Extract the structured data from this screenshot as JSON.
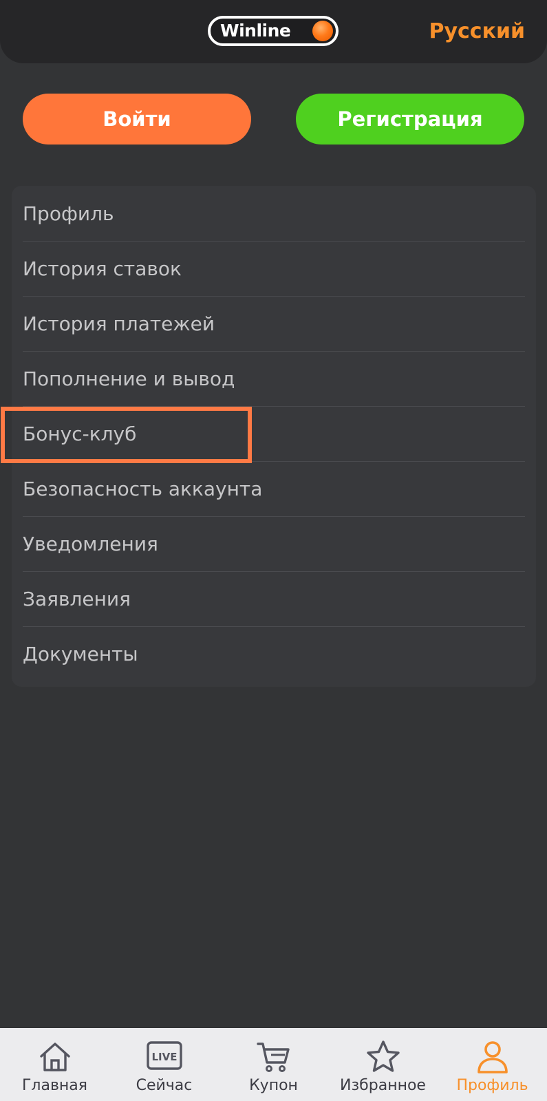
{
  "header": {
    "logo_text": "Winline",
    "language": "Русский"
  },
  "auth": {
    "login_label": "Войти",
    "register_label": "Регистрация"
  },
  "menu": {
    "items": [
      {
        "label": "Профиль"
      },
      {
        "label": "История ставок"
      },
      {
        "label": "История платежей"
      },
      {
        "label": "Пополнение и вывод"
      },
      {
        "label": "Бонус-клуб",
        "highlighted": true
      },
      {
        "label": "Безопасность аккаунта"
      },
      {
        "label": "Уведомления"
      },
      {
        "label": "Заявления"
      },
      {
        "label": "Документы"
      }
    ]
  },
  "tabbar": {
    "tabs": [
      {
        "label": "Главная",
        "icon": "home-icon"
      },
      {
        "label": "Сейчас",
        "icon": "live-icon",
        "icon_text": "LIVE"
      },
      {
        "label": "Купон",
        "icon": "cart-icon"
      },
      {
        "label": "Избранное",
        "icon": "star-icon"
      },
      {
        "label": "Профиль",
        "icon": "user-icon",
        "active": true
      }
    ]
  },
  "colors": {
    "background": "#333436",
    "header": "#262628",
    "accent_orange": "#f7902b",
    "login_button": "#ff763a",
    "register_button": "#4fd01f",
    "highlight_border": "#ff7a45"
  }
}
